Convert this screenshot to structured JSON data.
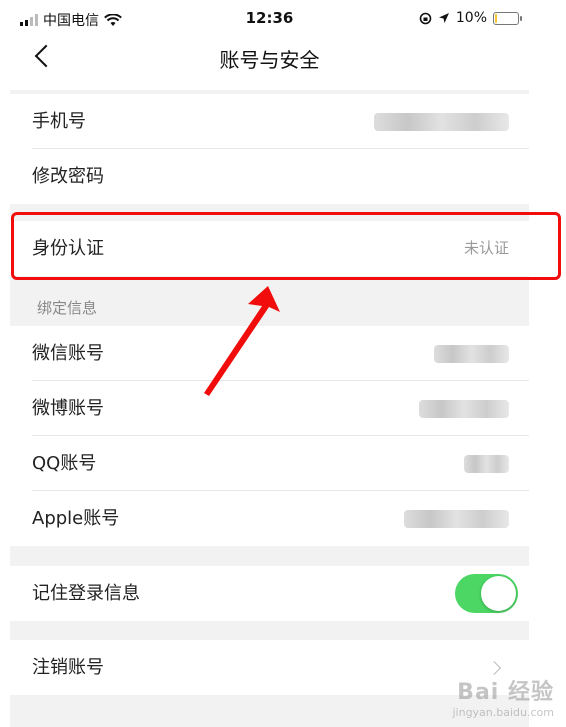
{
  "status_bar": {
    "carrier": "中国电信",
    "time": "12:36",
    "battery": "10%",
    "battery_level": 0.1,
    "icons": [
      "signal-icon",
      "wifi-icon",
      "rotation-lock-icon",
      "location-arrow-icon",
      "battery-icon"
    ]
  },
  "nav": {
    "title": "账号与安全",
    "back_icon": "chevron-left-icon"
  },
  "account_section": {
    "phone_label": "手机号",
    "password_label": "修改密码"
  },
  "identity": {
    "label": "身份认证",
    "status": "未认证"
  },
  "bindings": {
    "title": "绑定信息",
    "items": [
      {
        "label": "微信账号"
      },
      {
        "label": "微博账号"
      },
      {
        "label": "QQ账号"
      },
      {
        "label": "Apple账号"
      }
    ]
  },
  "remember_login": {
    "label": "记住登录信息",
    "enabled": true
  },
  "deactivate": {
    "label": "注销账号"
  },
  "annotation": {
    "highlight_color": "#f20d0d",
    "arrow_color": "#f20d0d"
  },
  "watermark": {
    "main": "Bai 经验",
    "sub": "jingyan.baidu.com"
  },
  "colors": {
    "toggle_on": "#4cd764",
    "page_bg": "#f2f2f2"
  }
}
